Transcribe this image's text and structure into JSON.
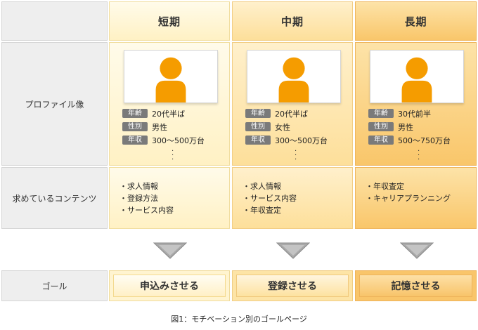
{
  "headers": {
    "col1": "短期",
    "col2": "中期",
    "col3": "長期"
  },
  "row_labels": {
    "profile": "プロファイル像",
    "contents": "求めているコンテンツ",
    "goal": "ゴール"
  },
  "badge_labels": {
    "age": "年齢",
    "gender": "性別",
    "income": "年収"
  },
  "profiles": [
    {
      "age": "20代半ば",
      "gender": "男性",
      "income": "300～500万台"
    },
    {
      "age": "20代半ば",
      "gender": "女性",
      "income": "300～500万台"
    },
    {
      "age": "30代前半",
      "gender": "男性",
      "income": "500～750万台"
    }
  ],
  "contents": [
    [
      "求人情報",
      "登録方法",
      "サービス内容"
    ],
    [
      "求人情報",
      "サービス内容",
      "年収査定"
    ],
    [
      "年収査定",
      "キャリアプランニング"
    ]
  ],
  "goals": [
    "申込みさせる",
    "登録させる",
    "記憶させる"
  ],
  "caption": "図1：モチベーション別のゴールページ",
  "colors": {
    "short": "#fff3cc",
    "mid": "#fde4a6",
    "long": "#f9c66a",
    "avatar": "#f59c00",
    "arrow": "#999999"
  },
  "icons": {
    "avatar": "person-silhouette-icon",
    "arrow": "down-triangle-icon"
  }
}
